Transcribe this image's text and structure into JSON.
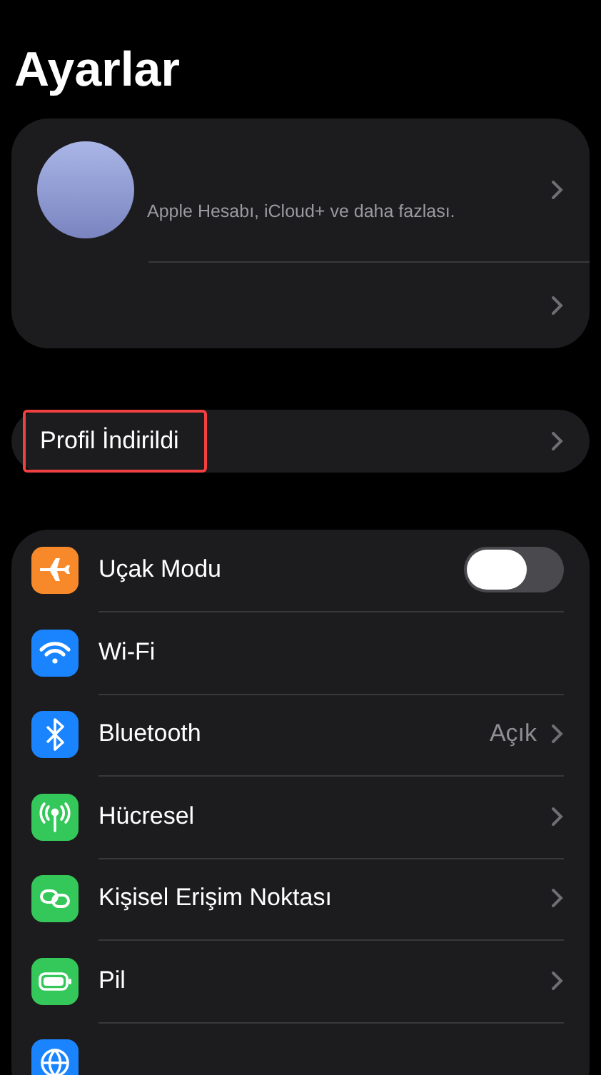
{
  "title": "Ayarlar",
  "account": {
    "subtitle": "Apple Hesabı, iCloud+ ve daha fazlası."
  },
  "profile_notice": {
    "label": "Profil İndirildi",
    "highlighted": true
  },
  "settings": [
    {
      "label": "Uçak Modu",
      "kind": "toggle",
      "on": false,
      "color": "#f7892b"
    },
    {
      "label": "Wi-Fi",
      "kind": "plain",
      "color": "#1a84ff"
    },
    {
      "label": "Bluetooth",
      "kind": "value",
      "value": "Açık",
      "color": "#1a84ff"
    },
    {
      "label": "Hücresel",
      "kind": "chevron",
      "color": "#34c759"
    },
    {
      "label": "Kişisel Erişim Noktası",
      "kind": "chevron",
      "color": "#34c759"
    },
    {
      "label": "Pil",
      "kind": "chevron",
      "color": "#34c759"
    },
    {
      "kind": "cut",
      "color": "#1a84ff"
    }
  ]
}
